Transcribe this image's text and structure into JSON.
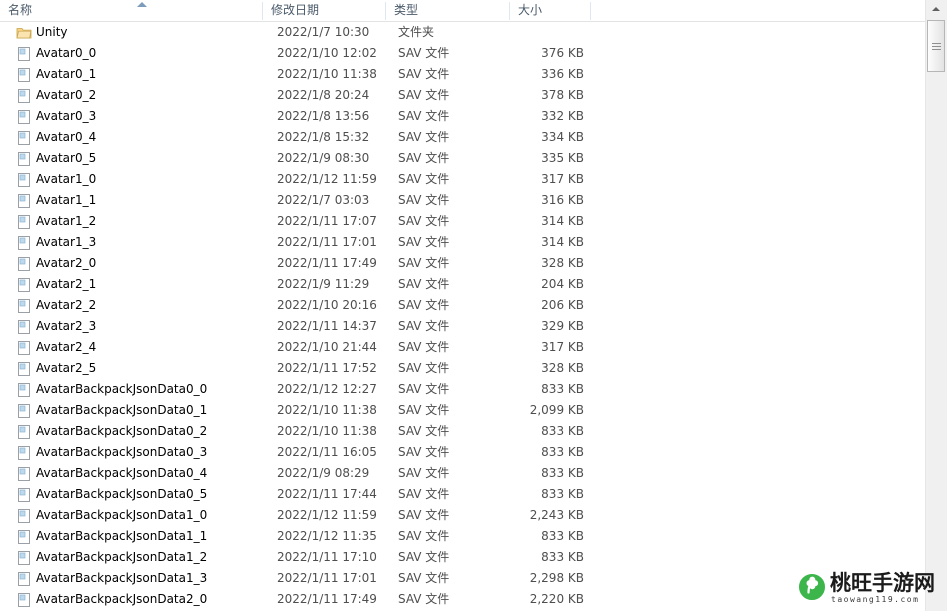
{
  "header": {
    "columns": [
      {
        "label": "名称",
        "key": "name"
      },
      {
        "label": "修改日期",
        "key": "date"
      },
      {
        "label": "类型",
        "key": "type"
      },
      {
        "label": "大小",
        "key": "size"
      }
    ],
    "sort_column": "名称",
    "sort_direction": "ascending"
  },
  "colors": {
    "header_text": "#4a5a6a",
    "row_text": "#000000",
    "secondary_text": "#4e4e4e",
    "separator": "#dfe7f0",
    "scrollbar_track": "#f0f0f0",
    "folder_icon": "#f5cd79",
    "watermark_green": "#3cb54a"
  },
  "rows": [
    {
      "icon": "folder-icon",
      "name": "Unity",
      "date": "2022/1/7 10:30",
      "type": "文件夹",
      "size": ""
    },
    {
      "icon": "sav-file-icon",
      "name": "Avatar0_0",
      "date": "2022/1/10 12:02",
      "type": "SAV 文件",
      "size": "376 KB"
    },
    {
      "icon": "sav-file-icon",
      "name": "Avatar0_1",
      "date": "2022/1/10 11:38",
      "type": "SAV 文件",
      "size": "336 KB"
    },
    {
      "icon": "sav-file-icon",
      "name": "Avatar0_2",
      "date": "2022/1/8 20:24",
      "type": "SAV 文件",
      "size": "378 KB"
    },
    {
      "icon": "sav-file-icon",
      "name": "Avatar0_3",
      "date": "2022/1/8 13:56",
      "type": "SAV 文件",
      "size": "332 KB"
    },
    {
      "icon": "sav-file-icon",
      "name": "Avatar0_4",
      "date": "2022/1/8 15:32",
      "type": "SAV 文件",
      "size": "334 KB"
    },
    {
      "icon": "sav-file-icon",
      "name": "Avatar0_5",
      "date": "2022/1/9 08:30",
      "type": "SAV 文件",
      "size": "335 KB"
    },
    {
      "icon": "sav-file-icon",
      "name": "Avatar1_0",
      "date": "2022/1/12 11:59",
      "type": "SAV 文件",
      "size": "317 KB"
    },
    {
      "icon": "sav-file-icon",
      "name": "Avatar1_1",
      "date": "2022/1/7 03:03",
      "type": "SAV 文件",
      "size": "316 KB"
    },
    {
      "icon": "sav-file-icon",
      "name": "Avatar1_2",
      "date": "2022/1/11 17:07",
      "type": "SAV 文件",
      "size": "314 KB"
    },
    {
      "icon": "sav-file-icon",
      "name": "Avatar1_3",
      "date": "2022/1/11 17:01",
      "type": "SAV 文件",
      "size": "314 KB"
    },
    {
      "icon": "sav-file-icon",
      "name": "Avatar2_0",
      "date": "2022/1/11 17:49",
      "type": "SAV 文件",
      "size": "328 KB"
    },
    {
      "icon": "sav-file-icon",
      "name": "Avatar2_1",
      "date": "2022/1/9 11:29",
      "type": "SAV 文件",
      "size": "204 KB"
    },
    {
      "icon": "sav-file-icon",
      "name": "Avatar2_2",
      "date": "2022/1/10 20:16",
      "type": "SAV 文件",
      "size": "206 KB"
    },
    {
      "icon": "sav-file-icon",
      "name": "Avatar2_3",
      "date": "2022/1/11 14:37",
      "type": "SAV 文件",
      "size": "329 KB"
    },
    {
      "icon": "sav-file-icon",
      "name": "Avatar2_4",
      "date": "2022/1/10 21:44",
      "type": "SAV 文件",
      "size": "317 KB"
    },
    {
      "icon": "sav-file-icon",
      "name": "Avatar2_5",
      "date": "2022/1/11 17:52",
      "type": "SAV 文件",
      "size": "328 KB"
    },
    {
      "icon": "sav-file-icon",
      "name": "AvatarBackpackJsonData0_0",
      "date": "2022/1/12 12:27",
      "type": "SAV 文件",
      "size": "833 KB"
    },
    {
      "icon": "sav-file-icon",
      "name": "AvatarBackpackJsonData0_1",
      "date": "2022/1/10 11:38",
      "type": "SAV 文件",
      "size": "2,099 KB"
    },
    {
      "icon": "sav-file-icon",
      "name": "AvatarBackpackJsonData0_2",
      "date": "2022/1/10 11:38",
      "type": "SAV 文件",
      "size": "833 KB"
    },
    {
      "icon": "sav-file-icon",
      "name": "AvatarBackpackJsonData0_3",
      "date": "2022/1/11 16:05",
      "type": "SAV 文件",
      "size": "833 KB"
    },
    {
      "icon": "sav-file-icon",
      "name": "AvatarBackpackJsonData0_4",
      "date": "2022/1/9 08:29",
      "type": "SAV 文件",
      "size": "833 KB"
    },
    {
      "icon": "sav-file-icon",
      "name": "AvatarBackpackJsonData0_5",
      "date": "2022/1/11 17:44",
      "type": "SAV 文件",
      "size": "833 KB"
    },
    {
      "icon": "sav-file-icon",
      "name": "AvatarBackpackJsonData1_0",
      "date": "2022/1/12 11:59",
      "type": "SAV 文件",
      "size": "2,243 KB"
    },
    {
      "icon": "sav-file-icon",
      "name": "AvatarBackpackJsonData1_1",
      "date": "2022/1/12 11:35",
      "type": "SAV 文件",
      "size": "833 KB"
    },
    {
      "icon": "sav-file-icon",
      "name": "AvatarBackpackJsonData1_2",
      "date": "2022/1/11 17:10",
      "type": "SAV 文件",
      "size": "833 KB"
    },
    {
      "icon": "sav-file-icon",
      "name": "AvatarBackpackJsonData1_3",
      "date": "2022/1/11 17:01",
      "type": "SAV 文件",
      "size": "2,298 KB"
    },
    {
      "icon": "sav-file-icon",
      "name": "AvatarBackpackJsonData2_0",
      "date": "2022/1/11 17:49",
      "type": "SAV 文件",
      "size": "2,220 KB"
    }
  ],
  "scrollbar": {
    "up_arrow_icon": "scroll-up-arrow-icon",
    "orientation": "vertical"
  },
  "watermark": {
    "title": "桃旺手游网",
    "url": "taowang119.com",
    "logo_icon": "clover-logo-icon"
  }
}
